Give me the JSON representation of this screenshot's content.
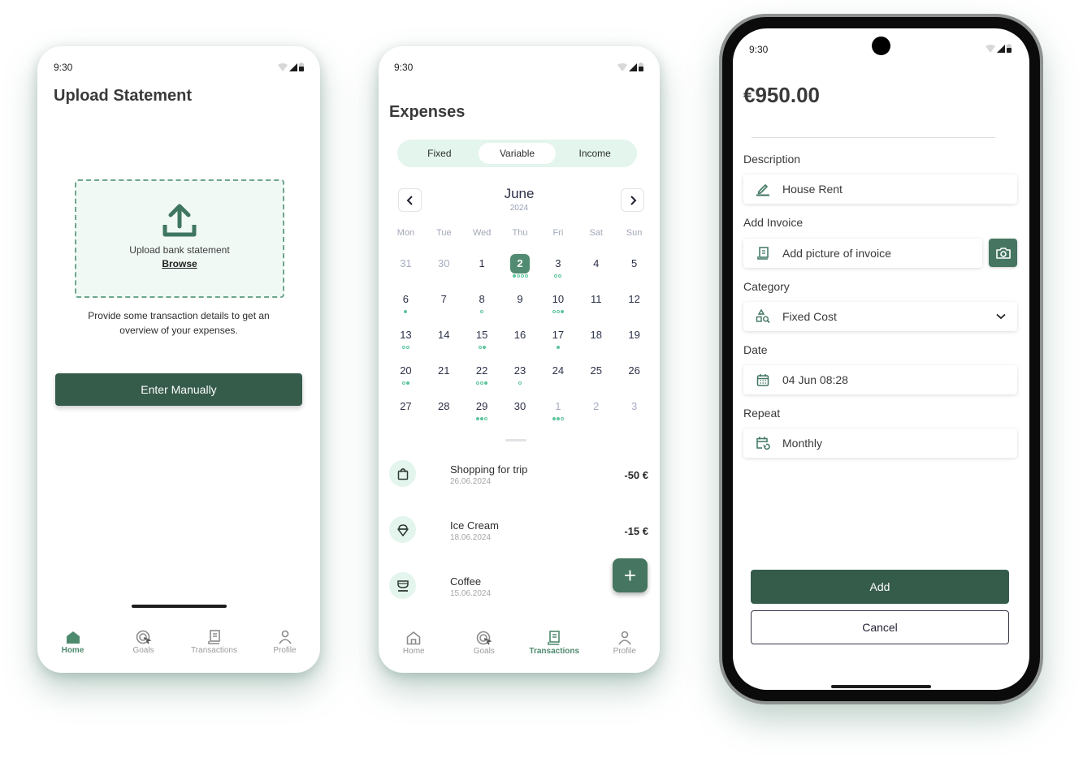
{
  "colors": {
    "primary": "#355b4b",
    "accent": "#4e8a6e",
    "light_accent": "#e3f5ec",
    "dot": "#5cc49b"
  },
  "upload_screen": {
    "status_time": "9:30",
    "title": "Upload Statement",
    "dropzone_text": "Upload bank statement",
    "browse_link": "Browse",
    "hint": "Provide some transaction details to get an overview of your expenses.",
    "enter_manually": "Enter Manually",
    "tabs": [
      {
        "label": "Home",
        "icon": "home-icon",
        "active": true
      },
      {
        "label": "Goals",
        "icon": "target-icon",
        "active": false
      },
      {
        "label": "Transactions",
        "icon": "receipt-icon",
        "active": false
      },
      {
        "label": "Profile",
        "icon": "user-icon",
        "active": false
      }
    ]
  },
  "expenses_screen": {
    "status_time": "9:30",
    "title": "Expenses",
    "segments": [
      {
        "label": "Fixed",
        "active": false
      },
      {
        "label": "Variable",
        "active": true
      },
      {
        "label": "Income",
        "active": false
      }
    ],
    "calendar": {
      "month": "June",
      "year": "2024",
      "weekdays": [
        "Mon",
        "Tue",
        "Wed",
        "Thu",
        "Fri",
        "Sat",
        "Sun"
      ],
      "weeks": [
        [
          {
            "d": "31",
            "muted": true,
            "dots": []
          },
          {
            "d": "30",
            "muted": true,
            "dots": []
          },
          {
            "d": "1",
            "dots": []
          },
          {
            "d": "2",
            "selected": true,
            "dots": [
              1,
              0,
              0,
              0
            ]
          },
          {
            "d": "3",
            "dots": [
              0,
              0
            ]
          },
          {
            "d": "4",
            "dots": []
          },
          {
            "d": "5",
            "dots": []
          }
        ],
        [
          {
            "d": "6",
            "dots": [
              1
            ]
          },
          {
            "d": "7",
            "dots": []
          },
          {
            "d": "8",
            "dots": [
              0
            ]
          },
          {
            "d": "9",
            "dots": []
          },
          {
            "d": "10",
            "dots": [
              0,
              0,
              1
            ]
          },
          {
            "d": "11",
            "dots": []
          },
          {
            "d": "12",
            "dots": []
          }
        ],
        [
          {
            "d": "13",
            "dots": [
              0,
              0
            ]
          },
          {
            "d": "14",
            "dots": []
          },
          {
            "d": "15",
            "dots": [
              0,
              1
            ]
          },
          {
            "d": "16",
            "dots": []
          },
          {
            "d": "17",
            "dots": [
              1
            ]
          },
          {
            "d": "18",
            "dots": []
          },
          {
            "d": "19",
            "dots": []
          }
        ],
        [
          {
            "d": "20",
            "dots": [
              0,
              1
            ]
          },
          {
            "d": "21",
            "dots": []
          },
          {
            "d": "22",
            "dots": [
              0,
              0,
              1
            ]
          },
          {
            "d": "23",
            "dots": [
              0
            ]
          },
          {
            "d": "24",
            "dots": []
          },
          {
            "d": "25",
            "dots": []
          },
          {
            "d": "26",
            "dots": []
          }
        ],
        [
          {
            "d": "27",
            "dots": []
          },
          {
            "d": "28",
            "dots": []
          },
          {
            "d": "29",
            "dots": [
              1,
              1,
              0
            ]
          },
          {
            "d": "30",
            "dots": []
          },
          {
            "d": "1",
            "muted": true,
            "dots": [
              1,
              1,
              0
            ]
          },
          {
            "d": "2",
            "muted": true,
            "dots": []
          },
          {
            "d": "3",
            "muted": true,
            "dots": []
          }
        ]
      ]
    },
    "transactions": [
      {
        "name": "Shopping for trip",
        "date": "26.06.2024",
        "amount": "-50 €",
        "icon": "shopping-bag-icon"
      },
      {
        "name": "Ice Cream",
        "date": "18.06.2024",
        "amount": "-15 €",
        "icon": "ice-cream-icon"
      },
      {
        "name": "Coffee",
        "date": "15.06.2024",
        "amount": "",
        "icon": "coffee-cup-icon"
      }
    ],
    "fab_label": "+",
    "tabs": [
      {
        "label": "Home",
        "icon": "home-icon",
        "active": false
      },
      {
        "label": "Goals",
        "icon": "target-icon",
        "active": false
      },
      {
        "label": "Transactions",
        "icon": "receipt-icon",
        "active": true
      },
      {
        "label": "Profile",
        "icon": "user-icon",
        "active": false
      }
    ]
  },
  "add_expense_screen": {
    "status_time": "9:30",
    "amount": "€950.00",
    "description_label": "Description",
    "description_value": "House Rent",
    "invoice_label": "Add Invoice",
    "invoice_value": "Add picture of invoice",
    "category_label": "Category",
    "category_value": "Fixed Cost",
    "date_label": "Date",
    "date_value": "04 Jun 08:28",
    "repeat_label": "Repeat",
    "repeat_value": "Monthly",
    "add_button": "Add",
    "cancel_button": "Cancel"
  }
}
